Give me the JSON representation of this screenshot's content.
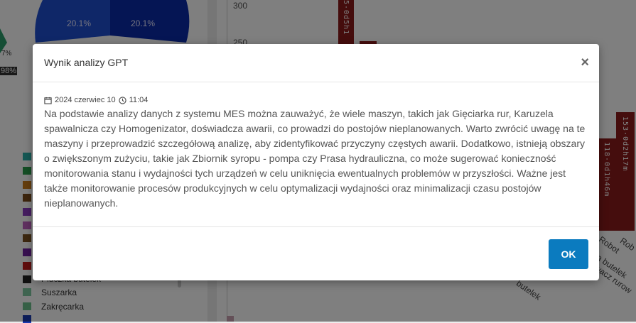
{
  "background": {
    "y_ticks": [
      "300",
      "250"
    ],
    "pie_labels": [
      "20.1%",
      "20.1%"
    ],
    "pie_edge_labels": [
      "7%",
      "98%"
    ],
    "bars": [
      {
        "label": "5·0d5h1"
      },
      {
        "label": "153·0d2h17m"
      },
      {
        "label": "118·0d1h46m"
      }
    ],
    "x_labels": [
      "Robot",
      "Rob",
      "ka butelek",
      "wacz rurow",
      "butelek"
    ],
    "legend": [
      {
        "label": "Suszarka",
        "color": "#7fc8a0"
      },
      {
        "label": "Zakręcarka",
        "color": "#7dc6a0"
      }
    ],
    "legend_partial": "Płuczka butelek"
  },
  "modal": {
    "title": "Wynik analizy GPT",
    "close_label": "×",
    "date": "2024 czerwiec 10",
    "time": "11:04",
    "body": "Na podstawie analizy danych z systemu MES można zauważyć, że wiele maszyn, takich jak Gięciarka rur, Karuzela spawalnicza czy Homogenizator, doświadcza awarii, co prowadzi do postojów nieplanowanych. Warto zwrócić uwagę na te maszyny i przeprowadzić szczegółową analizę, aby zidentyfikować przyczyny częstych awarii. Dodatkowo, istnieją obszary o zwiększonym zużyciu, takie jak Zbiornik syropu - pompa czy Prasa hydrauliczna, co może sugerować konieczność monitorowania stanu i wydajności tych urządzeń w celu uniknięcia ewentualnych problemów w przyszłości. Ważne jest także monitorowanie procesów produkcyjnych w celu optymalizacji wydajności oraz minimalizacji czasu postojów nieplanowanych.",
    "ok_label": "OK"
  }
}
